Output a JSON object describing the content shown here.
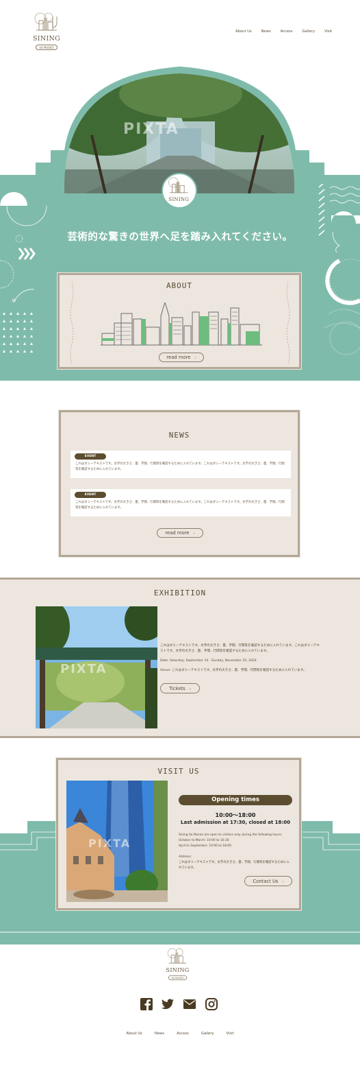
{
  "brand": {
    "name": "SINING",
    "sub": "SA MUSEO"
  },
  "nav": [
    "About Us",
    "News",
    "Access",
    "Gallery",
    "Visit"
  ],
  "hero": {
    "tagline": "芸術的な驚きの世界へ足を踏み入れてください。",
    "watermark": "PIXTA"
  },
  "about": {
    "title": "ABOUT",
    "button": "read more"
  },
  "news": {
    "title": "NEWS",
    "items": [
      {
        "badge": "EVENT",
        "text": "これはダミーテキストです。文字の大きさ、量、字間、行間等を確認するために入れています。これはダミーテキストです。文字の大きさ、量、字間、行間等を確認するために入れています。"
      },
      {
        "badge": "EVENT",
        "text": "これはダミーテキストです。文字の大きさ、量、字間、行間等を確認するために入れています。これはダミーテキストです。文字の大きさ、量、字間、行間等を確認するために入れています。"
      }
    ],
    "button": "read more"
  },
  "exhibition": {
    "title": "EXHIBITION",
    "description": "これはダミーテキストです。文字の大きさ、量、字間、行間等を確認するために入れています。これはダミーテキストです。文字の大きさ、量、字間、行間等を確認するために入れています。",
    "date": "Date: Saturday, September 14 - Sunday, November 10, 2024",
    "venue": "Venue: これはダミーテキストです。文字の大きさ、量、字間、行間等を確認するために入れています。",
    "button": "Tickets",
    "watermark": "PIXTA"
  },
  "visit": {
    "title": "VISIT US",
    "opening_label": "Opening times",
    "hours": "10:00～18:00",
    "last_admission": "Last admission at 17:30, closed at 18:00",
    "note_lines": [
      "Sining Sa Museo are open to visitors only during the following hours:",
      "October to March: 10:00 to 16:30",
      "April to September: 10:00 to 18:00"
    ],
    "address_label": "Address:",
    "address_text": "これはダミーテキストです。文字の大きさ、量、字間、行間等を確認するために入れています。",
    "button": "Contact Us",
    "watermark": "PIXTA"
  },
  "footer": {
    "social": [
      "facebook-icon",
      "twitter-icon",
      "mail-icon",
      "instagram-icon"
    ],
    "links": [
      "About Us",
      "News",
      "Access",
      "Gallery",
      "Visit"
    ]
  },
  "colors": {
    "teal": "#7fbbab",
    "beige": "#ece6df",
    "brown": "#5d4d30",
    "frame": "#b3a796"
  }
}
